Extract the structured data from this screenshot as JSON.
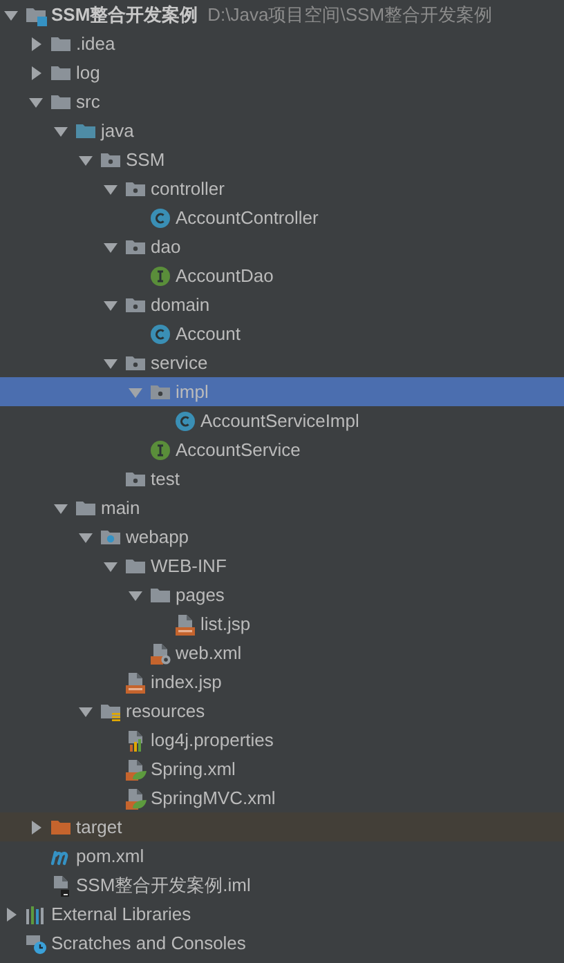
{
  "nodes": [
    {
      "label": "SSM整合开发案例",
      "path": "D:\\Java项目空间\\SSM整合开发案例",
      "kind": "module",
      "expanded": true,
      "selected": false,
      "children": [
        {
          "label": ".idea",
          "kind": "folder",
          "expanded": false,
          "selected": false
        },
        {
          "label": "log",
          "kind": "folder",
          "expanded": false,
          "selected": false
        },
        {
          "label": "src",
          "kind": "folder",
          "expanded": true,
          "selected": false,
          "children": [
            {
              "label": "java",
              "kind": "source",
              "expanded": true,
              "selected": false,
              "children": [
                {
                  "label": "SSM",
                  "kind": "package",
                  "expanded": true,
                  "selected": false,
                  "children": [
                    {
                      "label": "controller",
                      "kind": "package",
                      "expanded": true,
                      "selected": false,
                      "children": [
                        {
                          "label": "AccountController",
                          "kind": "class",
                          "selected": false
                        }
                      ]
                    },
                    {
                      "label": "dao",
                      "kind": "package",
                      "expanded": true,
                      "selected": false,
                      "children": [
                        {
                          "label": "AccountDao",
                          "kind": "interface",
                          "selected": false
                        }
                      ]
                    },
                    {
                      "label": "domain",
                      "kind": "package",
                      "expanded": true,
                      "selected": false,
                      "children": [
                        {
                          "label": "Account",
                          "kind": "class",
                          "selected": false
                        }
                      ]
                    },
                    {
                      "label": "service",
                      "kind": "package",
                      "expanded": true,
                      "selected": false,
                      "children": [
                        {
                          "label": "impl",
                          "kind": "package",
                          "expanded": true,
                          "selected": true,
                          "children": [
                            {
                              "label": "AccountServiceImpl",
                              "kind": "class",
                              "selected": false
                            }
                          ]
                        },
                        {
                          "label": "AccountService",
                          "kind": "interface",
                          "selected": false
                        }
                      ]
                    },
                    {
                      "label": "test",
                      "kind": "package",
                      "selected": false
                    }
                  ]
                }
              ]
            },
            {
              "label": "main",
              "kind": "folder",
              "expanded": true,
              "selected": false,
              "children": [
                {
                  "label": "webapp",
                  "kind": "web",
                  "expanded": true,
                  "selected": false,
                  "children": [
                    {
                      "label": "WEB-INF",
                      "kind": "folder",
                      "expanded": true,
                      "selected": false,
                      "children": [
                        {
                          "label": "pages",
                          "kind": "folder",
                          "expanded": true,
                          "selected": false,
                          "children": [
                            {
                              "label": "list.jsp",
                              "kind": "jsp",
                              "selected": false
                            }
                          ]
                        },
                        {
                          "label": "web.xml",
                          "kind": "webxml",
                          "selected": false
                        }
                      ]
                    },
                    {
                      "label": "index.jsp",
                      "kind": "jsp",
                      "selected": false
                    }
                  ]
                },
                {
                  "label": "resources",
                  "kind": "resources",
                  "expanded": true,
                  "selected": false,
                  "children": [
                    {
                      "label": "log4j.properties",
                      "kind": "properties",
                      "selected": false
                    },
                    {
                      "label": "Spring.xml",
                      "kind": "spring",
                      "selected": false
                    },
                    {
                      "label": "SpringMVC.xml",
                      "kind": "spring",
                      "selected": false
                    }
                  ]
                }
              ]
            }
          ]
        },
        {
          "label": "target",
          "kind": "excluded",
          "expanded": false,
          "selected": false
        },
        {
          "label": "pom.xml",
          "kind": "maven",
          "selected": false
        },
        {
          "label": "SSM整合开发案例.iml",
          "kind": "iml",
          "selected": false
        }
      ]
    },
    {
      "label": "External Libraries",
      "kind": "libraries",
      "expanded": false,
      "selected": false
    },
    {
      "label": "Scratches and Consoles",
      "kind": "scratches",
      "selected": false
    }
  ]
}
